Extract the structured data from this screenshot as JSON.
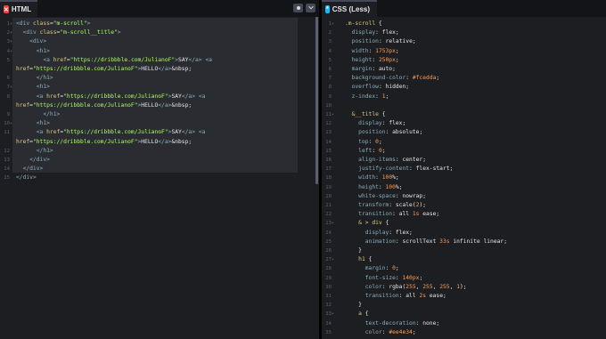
{
  "html_pane": {
    "tab_label": "HTML",
    "tab_icon": "html-icon",
    "icon_color": "#ff3c41",
    "lines": [
      {
        "n": "1",
        "text": "<div class=\"m-scroll\">"
      },
      {
        "n": "2",
        "text": "  <div class=\"m-scroll__title\">"
      },
      {
        "n": "3",
        "text": "    <div>"
      },
      {
        "n": "4",
        "text": "      <h1>"
      },
      {
        "n": "5",
        "text": "        <a href=\"https://dribbble.com/JulianoF\">SAY</a> <a"
      },
      {
        "n": "",
        "text": "href=\"https://dribbble.com/JulianoF\">HELLO</a>&nbsp;"
      },
      {
        "n": "6",
        "text": "      </h1>"
      },
      {
        "n": "7",
        "text": "      <h1>"
      },
      {
        "n": "8",
        "text": "      <a href=\"https://dribbble.com/JulianoF\">SAY</a> <a"
      },
      {
        "n": "",
        "text": "href=\"https://dribbble.com/JulianoF\">HELLO</a>&nbsp;"
      },
      {
        "n": "9",
        "text": "        </h1>"
      },
      {
        "n": "10",
        "text": "      <h1>"
      },
      {
        "n": "11",
        "text": "      <a href=\"https://dribbble.com/JulianoF\">SAY</a> <a"
      },
      {
        "n": "",
        "text": "href=\"https://dribbble.com/JulianoF\">HELLO</a>&nbsp;"
      },
      {
        "n": "12",
        "text": "      </h1>"
      },
      {
        "n": "13",
        "text": "    </div>"
      },
      {
        "n": "14",
        "text": "  </div>"
      },
      {
        "n": "15",
        "text": "</div>"
      }
    ]
  },
  "css_pane": {
    "tab_label": "CSS (Less)",
    "tab_icon": "css-icon",
    "icon_color": "#0ebeff",
    "lines": [
      {
        "n": "1",
        "text": ".m-scroll {"
      },
      {
        "n": "2",
        "text": "  display: flex;"
      },
      {
        "n": "3",
        "text": "  position: relative;"
      },
      {
        "n": "4",
        "text": "  width: 1753px;"
      },
      {
        "n": "5",
        "text": "  height: 250px;"
      },
      {
        "n": "6",
        "text": "  margin: auto;"
      },
      {
        "n": "7",
        "text": "  background-color: #fcedda;"
      },
      {
        "n": "8",
        "text": "  overflow: hidden;"
      },
      {
        "n": "9",
        "text": "  z-index: 1;"
      },
      {
        "n": "10",
        "text": ""
      },
      {
        "n": "11",
        "text": "  &__title {"
      },
      {
        "n": "12",
        "text": "    display: flex;"
      },
      {
        "n": "13",
        "text": "    position: absolute;"
      },
      {
        "n": "14",
        "text": "    top: 0;"
      },
      {
        "n": "15",
        "text": "    left: 0;"
      },
      {
        "n": "16",
        "text": "    align-items: center;"
      },
      {
        "n": "17",
        "text": "    justify-content: flex-start;"
      },
      {
        "n": "18",
        "text": "    width: 100%;"
      },
      {
        "n": "19",
        "text": "    height: 100%;"
      },
      {
        "n": "20",
        "text": "    white-space: nowrap;"
      },
      {
        "n": "21",
        "text": "    transform: scale(2);"
      },
      {
        "n": "22",
        "text": "    transition: all 1s ease;"
      },
      {
        "n": "23",
        "text": "    & > div {"
      },
      {
        "n": "24",
        "text": "      display: flex;"
      },
      {
        "n": "25",
        "text": "      animation: scrollText 33s infinite linear;"
      },
      {
        "n": "26",
        "text": "    }"
      },
      {
        "n": "27",
        "text": "    h1 {"
      },
      {
        "n": "28",
        "text": "      margin: 0;"
      },
      {
        "n": "29",
        "text": "      font-size: 140px;"
      },
      {
        "n": "30",
        "text": "      color: rgba(255, 255, 255, 1);"
      },
      {
        "n": "31",
        "text": "      transition: all 2s ease;"
      },
      {
        "n": "32",
        "text": "    }"
      },
      {
        "n": "33",
        "text": "    a {"
      },
      {
        "n": "34",
        "text": "      text-decoration: none;"
      },
      {
        "n": "35",
        "text": "      color: #ee4e34;"
      }
    ]
  },
  "colors": {
    "tag": "#88afbf",
    "attr": "#ddca7e",
    "string": "#a8ff60",
    "selector": "#ddca7e",
    "property": "#88afbf",
    "value": "#e6e6e6",
    "number": "#ff9d4d",
    "keyword": "#ddca7e"
  }
}
